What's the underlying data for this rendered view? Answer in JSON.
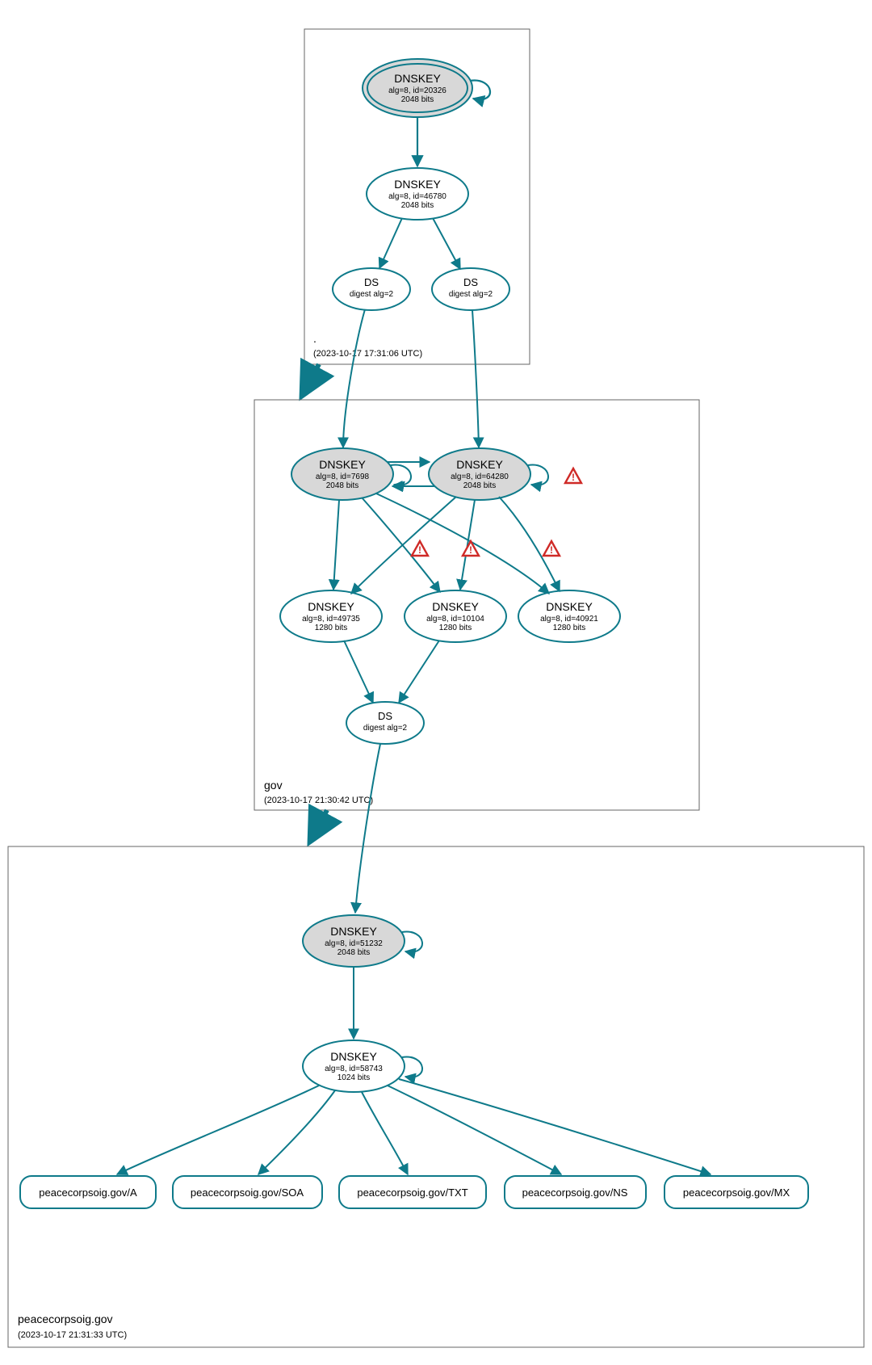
{
  "zones": {
    "root": {
      "label": ".",
      "timestamp": "(2023-10-17 17:31:06 UTC)"
    },
    "gov": {
      "label": "gov",
      "timestamp": "(2023-10-17 21:30:42 UTC)"
    },
    "leaf": {
      "label": "peacecorpsoig.gov",
      "timestamp": "(2023-10-17 21:31:33 UTC)"
    }
  },
  "nodes": {
    "root_ksk": {
      "title": "DNSKEY",
      "line2": "alg=8, id=20326",
      "line3": "2048 bits"
    },
    "root_zsk": {
      "title": "DNSKEY",
      "line2": "alg=8, id=46780",
      "line3": "2048 bits"
    },
    "root_ds1": {
      "title": "DS",
      "line2": "digest alg=2"
    },
    "root_ds2": {
      "title": "DS",
      "line2": "digest alg=2"
    },
    "gov_ksk1": {
      "title": "DNSKEY",
      "line2": "alg=8, id=7698",
      "line3": "2048 bits"
    },
    "gov_ksk2": {
      "title": "DNSKEY",
      "line2": "alg=8, id=64280",
      "line3": "2048 bits"
    },
    "gov_zsk1": {
      "title": "DNSKEY",
      "line2": "alg=8, id=49735",
      "line3": "1280 bits"
    },
    "gov_zsk2": {
      "title": "DNSKEY",
      "line2": "alg=8, id=10104",
      "line3": "1280 bits"
    },
    "gov_zsk3": {
      "title": "DNSKEY",
      "line2": "alg=8, id=40921",
      "line3": "1280 bits"
    },
    "gov_ds": {
      "title": "DS",
      "line2": "digest alg=2"
    },
    "leaf_ksk": {
      "title": "DNSKEY",
      "line2": "alg=8, id=51232",
      "line3": "2048 bits"
    },
    "leaf_zsk": {
      "title": "DNSKEY",
      "line2": "alg=8, id=58743",
      "line3": "1024 bits"
    }
  },
  "records": {
    "a": "peacecorpsoig.gov/A",
    "soa": "peacecorpsoig.gov/SOA",
    "txt": "peacecorpsoig.gov/TXT",
    "ns": "peacecorpsoig.gov/NS",
    "mx": "peacecorpsoig.gov/MX"
  },
  "colors": {
    "line": "#0e7a8a",
    "nodeFill": "#d8d8d8",
    "boxStroke": "#666",
    "warnFill": "#ffffff",
    "warnStroke": "#cf2a27"
  }
}
